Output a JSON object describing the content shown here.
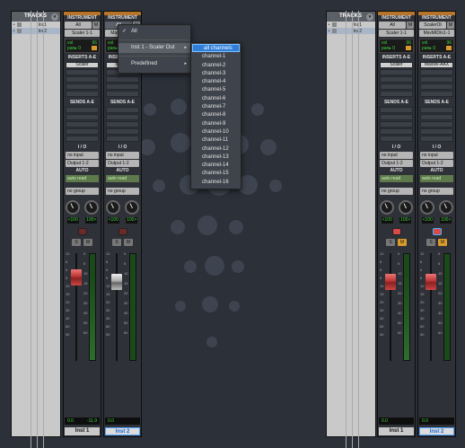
{
  "tracks_panel": {
    "title": "TRACKS",
    "tracks": [
      "Ins1",
      "Ins2"
    ]
  },
  "mixer_left": {
    "strips": [
      {
        "instrument_label": "INSTRUMENT",
        "select": "All",
        "inst_name": "Scaler 1-1",
        "vol_label": "vol",
        "vol": "96",
        "pan_label": "pan",
        "pan": "0",
        "inserts_label": "INSERTS A-E",
        "insert1": "Scaler",
        "sends_label": "SENDS A-E",
        "io_label": "I / O",
        "input": "no input",
        "output": "Output 1-2",
        "auto_label": "AUTO",
        "auto": "auto read",
        "group": "no group",
        "pan_l": "<100",
        "pan_r": "100>",
        "readout_l": "0.0",
        "readout_r": "-11.9",
        "name": "Inst 1",
        "m_label": "M",
        "s_label": "S"
      },
      {
        "instrument_label": "INSTRUMENT",
        "select": "All",
        "inst_name": "MassiveInst",
        "vol_label": "vol",
        "vol": "96",
        "pan_label": "pan",
        "pan": "0",
        "inserts_label": "INSERTS A-E",
        "insert1": "Massiv",
        "sends_label": "SENDS A-E",
        "io_label": "I / O",
        "input": "no input",
        "output": "Output 1-2",
        "auto_label": "AUTO",
        "auto": "auto read",
        "group": "no group",
        "pan_l": "<100",
        "pan_r": "100>",
        "readout_l": "0.0",
        "readout_r": "",
        "name": "Inst 2",
        "m_label": "M",
        "s_label": "S"
      }
    ]
  },
  "mixer_right": {
    "strips": [
      {
        "instrument_label": "INSTRUMENT",
        "select": "All",
        "inst_name": "Scaler 1-1",
        "vol_label": "vol",
        "vol": "96",
        "pan_label": "pan",
        "pan": "0",
        "inserts_label": "INSERTS A-E",
        "insert1": "Scaler",
        "sends_label": "SENDS A-E",
        "io_label": "I / O",
        "input": "no input",
        "output": "Output 1-2",
        "auto_label": "AUTO",
        "auto": "auto read",
        "group": "no group",
        "pan_l": "<100",
        "pan_r": "100>",
        "readout_l": "0.0",
        "readout_r": "",
        "name": "Inst 1",
        "m_label": "M",
        "s_label": "S"
      },
      {
        "instrument_label": "INSTRUMENT",
        "select": "ScalerOt",
        "inst_name": "MsvMIDIn1-1",
        "vol_label": "vol",
        "vol": "96",
        "pan_label": "pan",
        "pan": "0",
        "inserts_label": "INSERTS A-E",
        "insert1": "Massiv-AAX",
        "sends_label": "SENDS A-E",
        "io_label": "I / O",
        "input": "no input",
        "output": "Output 1-2",
        "auto_label": "AUTO",
        "auto": "auto read",
        "group": "no group",
        "pan_l": "<100",
        "pan_r": "100>",
        "readout_l": "0.0",
        "readout_r": "",
        "name": "Inst 2",
        "m_label": "M",
        "s_label": "S"
      }
    ]
  },
  "fader_scale": [
    "12",
    "6",
    "0",
    "5",
    "10",
    "15",
    "20",
    "30",
    "40",
    "60",
    "90"
  ],
  "meter_scale": [
    "0",
    "5",
    "10",
    "15",
    "20",
    "30",
    "40",
    "50",
    "60"
  ],
  "context_menu": {
    "items": [
      {
        "label": "All",
        "checked": "✓"
      },
      {
        "label": "Inst 1 - Scaler Out",
        "arrow": "▸"
      },
      {
        "label": "Predefined",
        "arrow": "▸"
      }
    ]
  },
  "submenu": {
    "items": [
      "all channels",
      "channel-1",
      "channel-2",
      "channel-3",
      "channel-4",
      "channel-5",
      "channel-6",
      "channel-7",
      "channel-8",
      "channel-9",
      "channel-10",
      "channel-11",
      "channel-12",
      "channel-13",
      "channel-14",
      "channel-15",
      "channel-16"
    ]
  },
  "colors": {
    "accent": "#2f7fd8",
    "background": "#2b3039",
    "strip_top": "#b8752a"
  }
}
